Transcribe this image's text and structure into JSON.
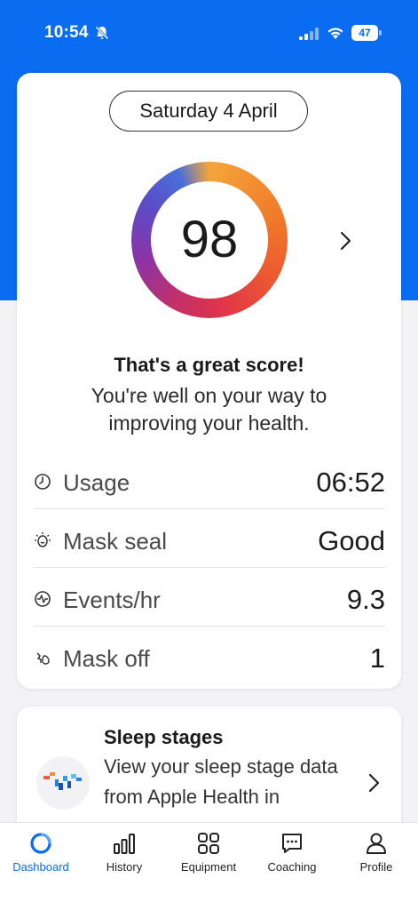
{
  "status_bar": {
    "time": "10:54",
    "battery": "47"
  },
  "score_card": {
    "date": "Saturday 4 April",
    "score": "98",
    "title": "That's a great score!",
    "message": "You're well on your way to improving your health.",
    "metrics": [
      {
        "icon": "clock-icon",
        "label": "Usage",
        "value": "06:52"
      },
      {
        "icon": "mask-seal-icon",
        "label": "Mask seal",
        "value": "Good"
      },
      {
        "icon": "pulse-icon",
        "label": "Events/hr",
        "value": "9.3"
      },
      {
        "icon": "mask-off-icon",
        "label": "Mask off",
        "value": "1"
      }
    ]
  },
  "sleep_card": {
    "title": "Sleep stages",
    "description": "View your sleep stage data from Apple Health in"
  },
  "bottom_nav": {
    "items": [
      {
        "label": "Dashboard",
        "icon": "dashboard-ring-icon",
        "active": true
      },
      {
        "label": "History",
        "icon": "bar-chart-icon",
        "active": false
      },
      {
        "label": "Equipment",
        "icon": "grid-icon",
        "active": false
      },
      {
        "label": "Coaching",
        "icon": "chat-icon",
        "active": false
      },
      {
        "label": "Profile",
        "icon": "person-icon",
        "active": false
      }
    ]
  },
  "colors": {
    "brand_blue": "#0a6cf0"
  }
}
